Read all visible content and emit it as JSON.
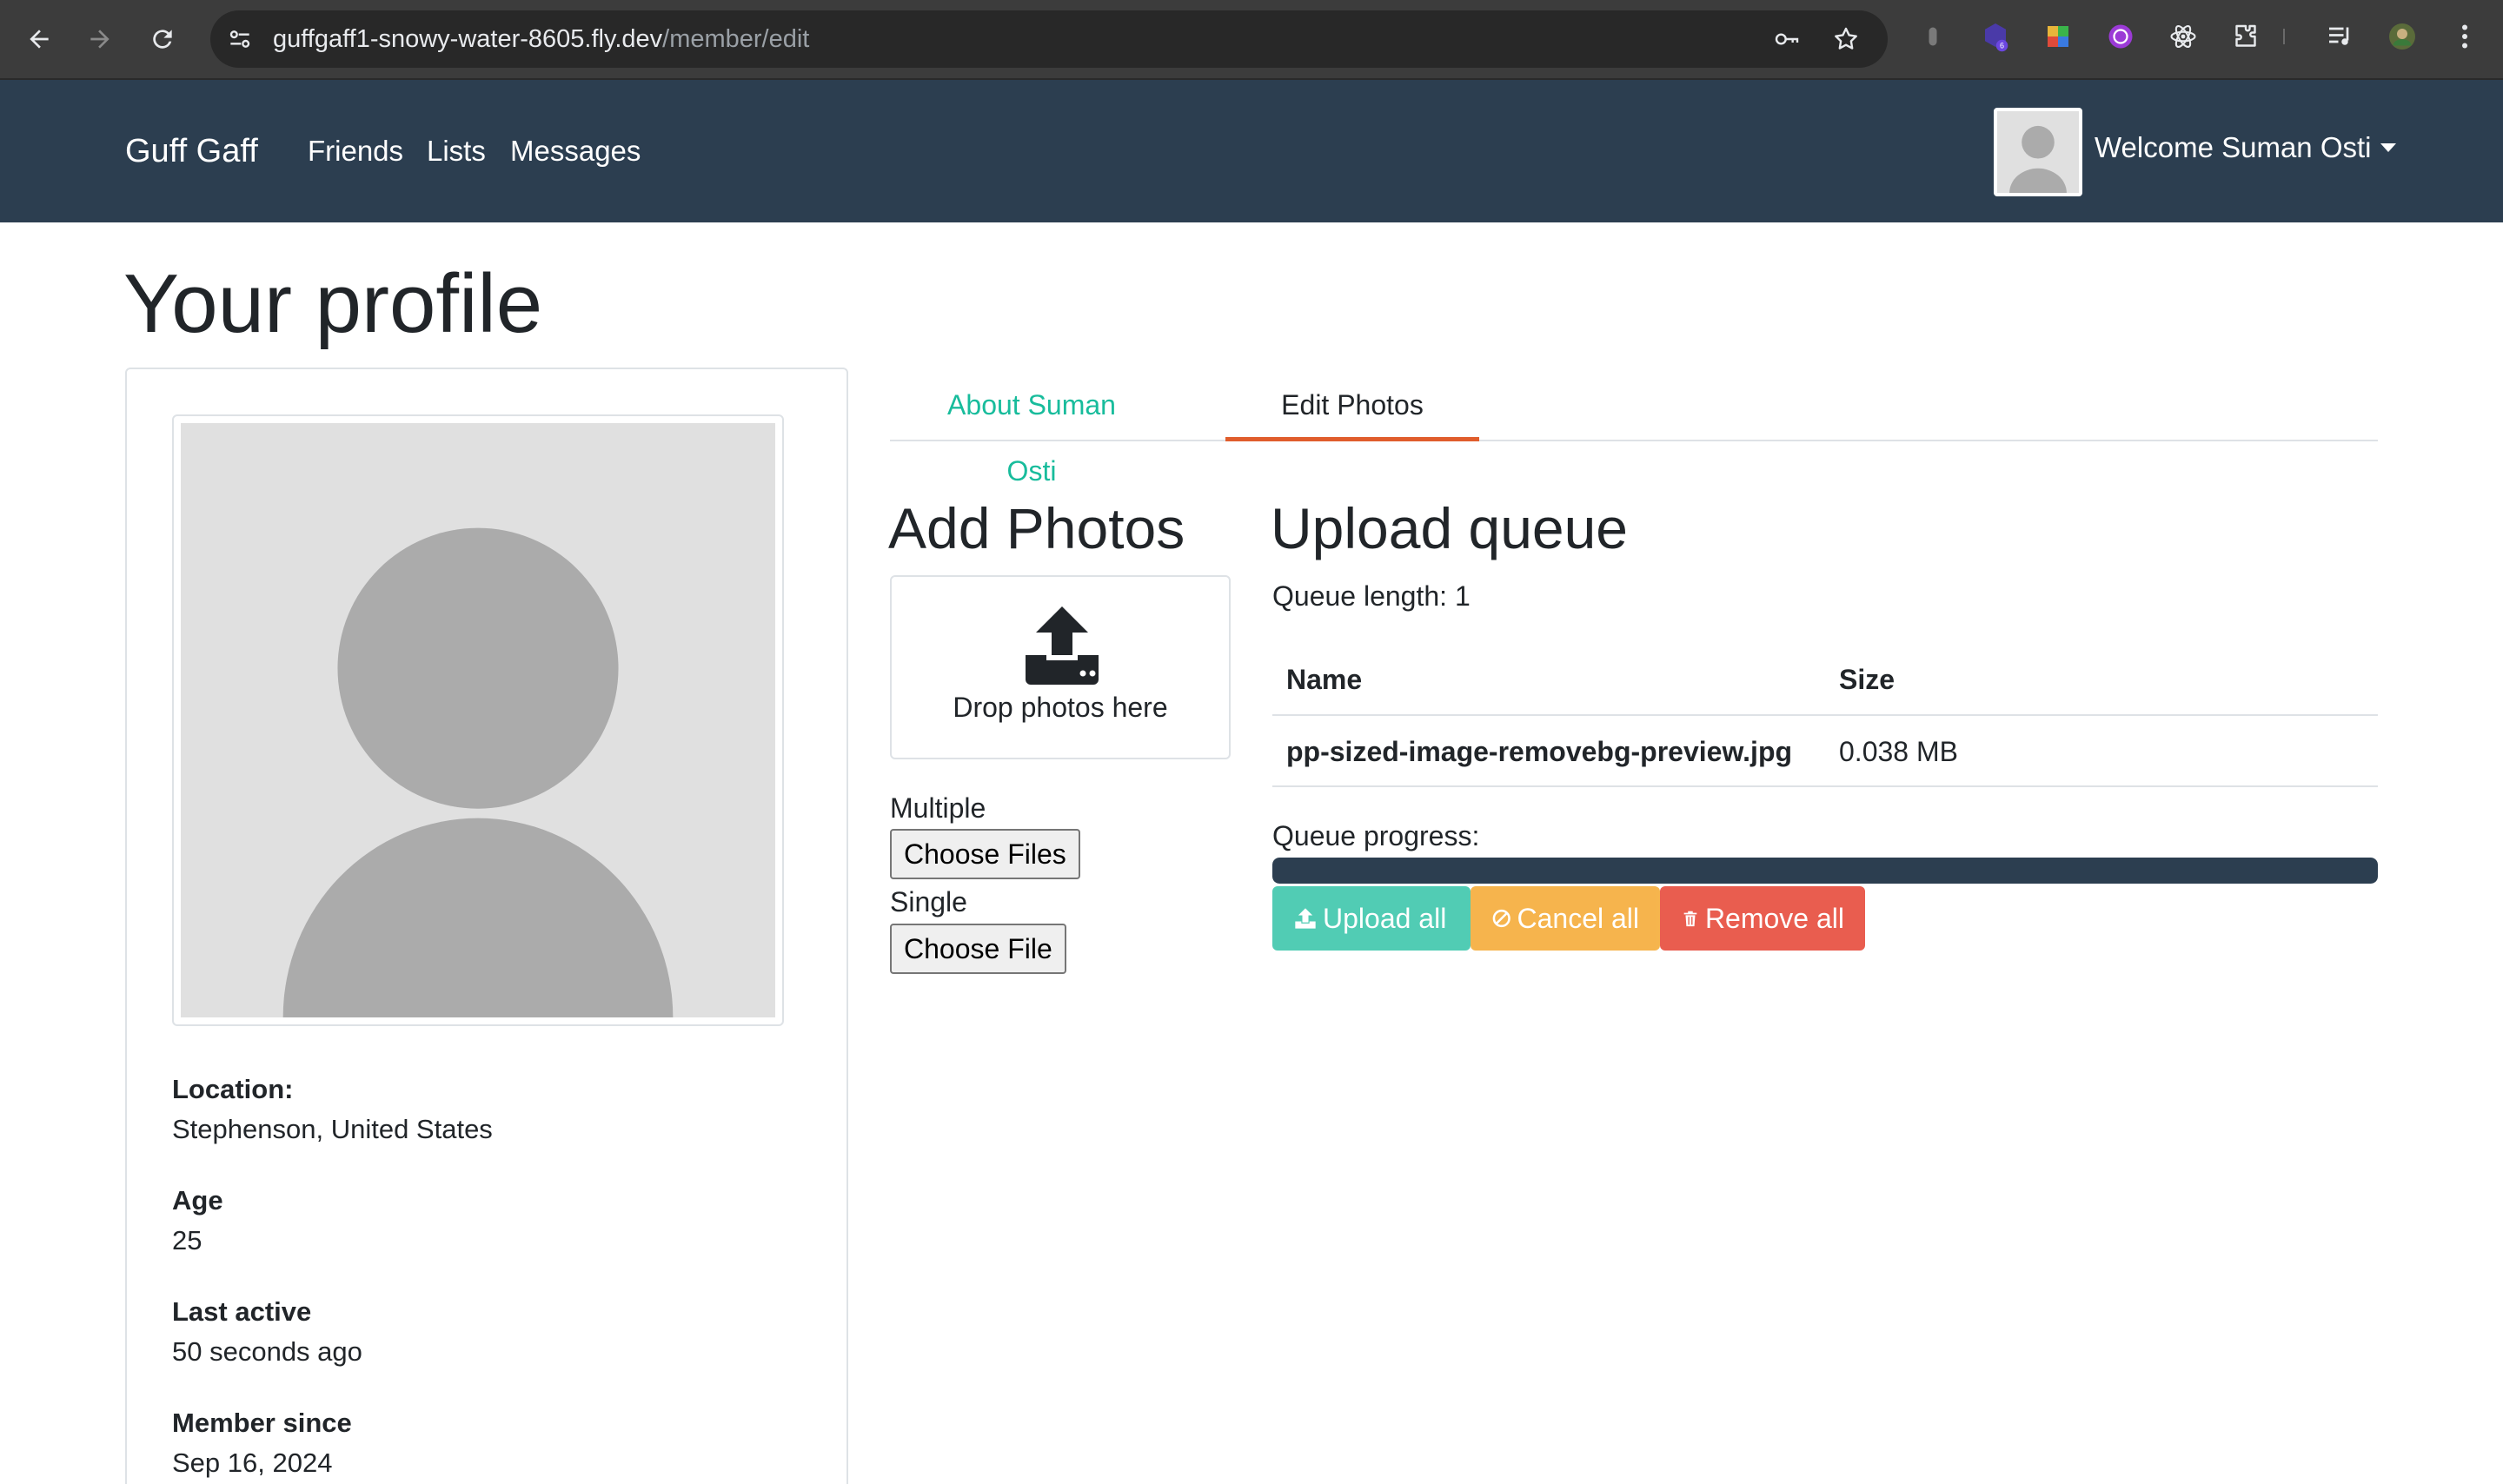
{
  "browser": {
    "url_host": "guffgaff1-snowy-water-8605.fly.dev",
    "url_path": "/member/edit",
    "extension_badge": "6",
    "icons": [
      "back-icon",
      "forward-icon",
      "reload-icon",
      "site-info-icon",
      "key-icon",
      "star-icon",
      "extensions-puzzle-icon",
      "media-icon",
      "profile-avatar-icon",
      "menu-icon"
    ]
  },
  "navbar": {
    "brand": "Guff Gaff",
    "links": [
      "Friends",
      "Lists",
      "Messages"
    ],
    "welcome": "Welcome Suman Osti"
  },
  "page": {
    "title": "Your profile"
  },
  "profile": {
    "fields": [
      {
        "label": "Location:",
        "value": "Stephenson, United States"
      },
      {
        "label": "Age",
        "value": "25"
      },
      {
        "label": "Last active",
        "value": "50 seconds ago"
      },
      {
        "label": "Member since",
        "value": "Sep 16, 2024"
      }
    ]
  },
  "tabs": [
    {
      "label": "About Suman Osti",
      "active": false
    },
    {
      "label": "Edit Photos",
      "active": true
    }
  ],
  "add_photos": {
    "heading": "Add Photos",
    "drop_text": "Drop photos here",
    "multiple_label": "Multiple",
    "multiple_button": "Choose Files",
    "single_label": "Single",
    "single_button": "Choose File"
  },
  "upload_queue": {
    "heading": "Upload queue",
    "queue_length": "Queue length: 1",
    "columns": [
      "Name",
      "Size"
    ],
    "rows": [
      {
        "name": "pp-sized-image-removebg-preview.jpg",
        "size": "0.038 MB"
      }
    ],
    "progress_label": "Queue progress:",
    "progress_percent": 100,
    "buttons": {
      "upload_all": "Upload all",
      "cancel_all": "Cancel all",
      "remove_all": "Remove all"
    }
  },
  "colors": {
    "navbar": "#2c3e50",
    "success": "#18bc9c",
    "warning": "#f39c12",
    "danger": "#e74c3c",
    "tab_underline": "#e05d2c"
  }
}
